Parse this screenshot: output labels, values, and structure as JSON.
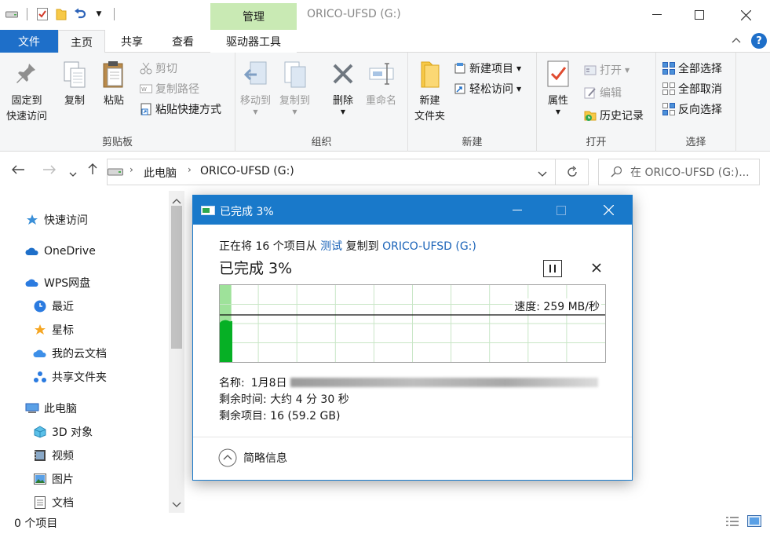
{
  "window": {
    "title": "ORICO-UFSD (G:)",
    "context_tab_label": "管理",
    "help_label": "?"
  },
  "tabs": {
    "file": "文件",
    "home": "主页",
    "share": "共享",
    "view": "查看",
    "drive_tools": "驱动器工具"
  },
  "ribbon": {
    "clipboard": {
      "label": "剪贴板",
      "pin": [
        "固定到",
        "快速访问"
      ],
      "copy": "复制",
      "paste": "粘贴",
      "cut": "剪切",
      "copy_path": "复制路径",
      "paste_shortcut": "粘贴快捷方式"
    },
    "organize": {
      "label": "组织",
      "move_to": "移动到",
      "copy_to": "复制到",
      "delete": "删除",
      "rename": "重命名"
    },
    "new": {
      "label": "新建",
      "new_folder": [
        "新建",
        "文件夹"
      ],
      "new_item": "新建项目",
      "easy_access": "轻松访问"
    },
    "open": {
      "label": "打开",
      "properties": "属性",
      "open": "打开",
      "edit": "编辑",
      "history": "历史记录"
    },
    "select": {
      "label": "选择",
      "select_all": "全部选择",
      "select_none": "全部取消",
      "invert": "反向选择"
    }
  },
  "address": {
    "crumbs": [
      "此电脑",
      "ORICO-UFSD (G:)"
    ],
    "search_placeholder": "在 ORICO-UFSD (G:)..."
  },
  "nav": [
    {
      "label": "快速访问",
      "icon": "star-icon"
    },
    {
      "label": "OneDrive",
      "icon": "cloud-icon"
    },
    {
      "label": "WPS网盘",
      "icon": "cloud-icon"
    },
    {
      "label": "最近",
      "icon": "clock-icon"
    },
    {
      "label": "星标",
      "icon": "star-icon"
    },
    {
      "label": "我的云文档",
      "icon": "cloud-icon"
    },
    {
      "label": "共享文件夹",
      "icon": "share-icon"
    },
    {
      "label": "此电脑",
      "icon": "computer-icon"
    },
    {
      "label": "3D 对象",
      "icon": "cube-icon"
    },
    {
      "label": "视频",
      "icon": "video-icon"
    },
    {
      "label": "图片",
      "icon": "picture-icon"
    },
    {
      "label": "文档",
      "icon": "document-icon"
    }
  ],
  "status": {
    "items": "0 个项目"
  },
  "dialog": {
    "title": "已完成 3%",
    "desc_prefix": "正在将 16 个项目从",
    "source": "测试",
    "desc_mid": "复制到",
    "dest": "ORICO-UFSD (G:)",
    "heading": "已完成 3%",
    "speed": "速度: 259 MB/秒",
    "progress_percent": 3,
    "name_label": "名称:",
    "name_value": "1月8日",
    "time_left": "剩余时间: 大约 4 分 30 秒",
    "items_left": "剩余项目: 16 (59.2 GB)",
    "footer_toggle": "简略信息",
    "colors": {
      "accent": "#1979ca",
      "progress": "#06b025",
      "progress_light": "#9ee29a"
    }
  }
}
